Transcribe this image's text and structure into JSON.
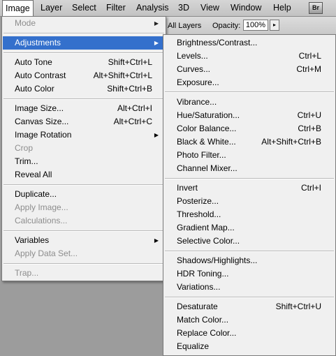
{
  "menubar": {
    "items": [
      "Image",
      "Layer",
      "Select",
      "Filter",
      "Analysis",
      "3D",
      "View",
      "Window",
      "Help"
    ],
    "bridge_icon": "Br"
  },
  "options_bar": {
    "layers_label": "All Layers",
    "opacity_label": "Opacity:",
    "opacity_value": "100%",
    "arrow_glyph": "▸"
  },
  "image_menu": {
    "mode": "Mode",
    "adjustments": "Adjustments",
    "auto_tone": "Auto Tone",
    "auto_tone_sc": "Shift+Ctrl+L",
    "auto_contrast": "Auto Contrast",
    "auto_contrast_sc": "Alt+Shift+Ctrl+L",
    "auto_color": "Auto Color",
    "auto_color_sc": "Shift+Ctrl+B",
    "image_size": "Image Size...",
    "image_size_sc": "Alt+Ctrl+I",
    "canvas_size": "Canvas Size...",
    "canvas_size_sc": "Alt+Ctrl+C",
    "image_rotation": "Image Rotation",
    "crop": "Crop",
    "trim": "Trim...",
    "reveal_all": "Reveal All",
    "duplicate": "Duplicate...",
    "apply_image": "Apply Image...",
    "calculations": "Calculations...",
    "variables": "Variables",
    "apply_data_set": "Apply Data Set...",
    "trap": "Trap...",
    "submenu_arrow": "▶"
  },
  "adjust_menu": {
    "brightness": "Brightness/Contrast...",
    "levels": "Levels...",
    "levels_sc": "Ctrl+L",
    "curves": "Curves...",
    "curves_sc": "Ctrl+M",
    "exposure": "Exposure...",
    "vibrance": "Vibrance...",
    "hue_sat": "Hue/Saturation...",
    "hue_sat_sc": "Ctrl+U",
    "color_balance": "Color Balance...",
    "color_balance_sc": "Ctrl+B",
    "bw": "Black & White...",
    "bw_sc": "Alt+Shift+Ctrl+B",
    "photo_filter": "Photo Filter...",
    "channel_mixer": "Channel Mixer...",
    "invert": "Invert",
    "invert_sc": "Ctrl+I",
    "posterize": "Posterize...",
    "threshold": "Threshold...",
    "gradient_map": "Gradient Map...",
    "selective_color": "Selective Color...",
    "shadows_highlights": "Shadows/Highlights...",
    "hdr_toning": "HDR Toning...",
    "variations": "Variations...",
    "desaturate": "Desaturate",
    "desaturate_sc": "Shift+Ctrl+U",
    "match_color": "Match Color...",
    "replace_color": "Replace Color...",
    "equalize": "Equalize"
  },
  "colors": {
    "highlight": "#3470cc",
    "menu_bg": "#f0f0f0",
    "disabled_text": "#8d8d8d"
  }
}
